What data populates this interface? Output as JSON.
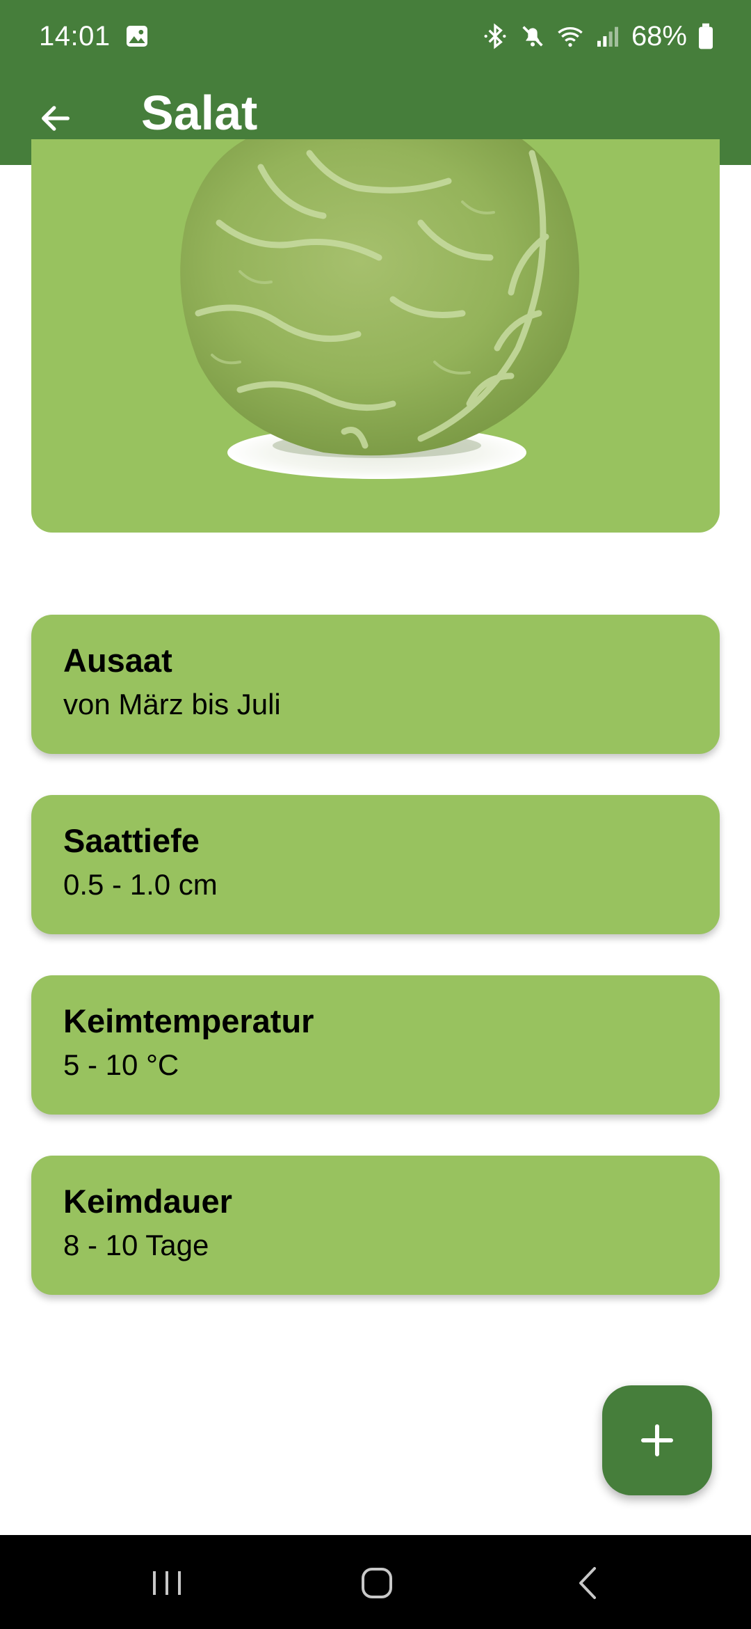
{
  "status_bar": {
    "time": "14:01",
    "battery": "68%",
    "icons": [
      "gallery-icon",
      "bluetooth-icon",
      "mute-icon",
      "wifi-icon",
      "signal-icon",
      "battery-icon"
    ]
  },
  "app_bar": {
    "back_icon": "arrow-left-icon",
    "title": "Salat"
  },
  "hero": {
    "image": "lettuce-illustration"
  },
  "info_cards": [
    {
      "title": "Ausaat",
      "value": "von März bis Juli"
    },
    {
      "title": "Saattiefe",
      "value": "0.5 - 1.0 cm"
    },
    {
      "title": "Keimtemperatur",
      "value": "5 - 10 °C"
    },
    {
      "title": "Keimdauer",
      "value": "8 - 10 Tage"
    }
  ],
  "fab": {
    "icon": "plus-icon"
  },
  "nav_bar": {
    "buttons": [
      "recent-apps-icon",
      "home-icon",
      "back-nav-icon"
    ]
  },
  "colors": {
    "primary": "#467e3b",
    "card": "#98c25f",
    "background": "#ffffff"
  }
}
